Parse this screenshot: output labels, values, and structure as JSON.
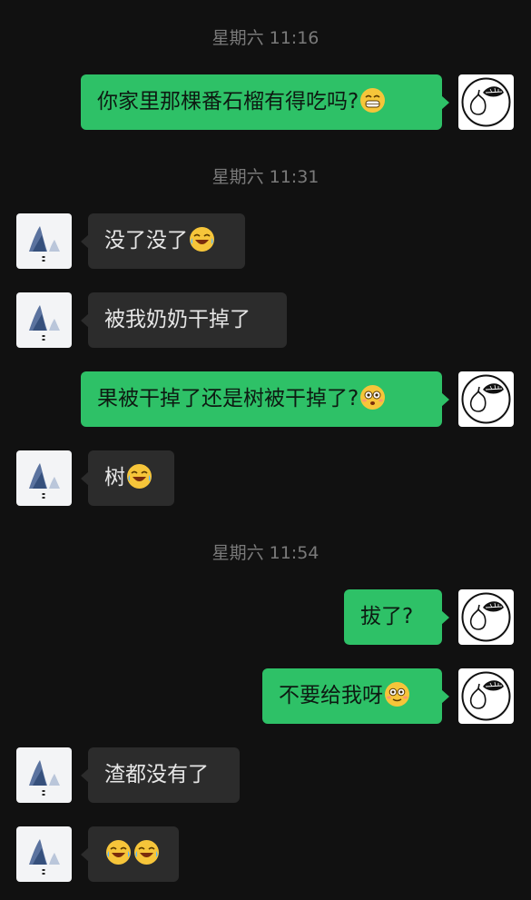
{
  "colors": {
    "background": "#111111",
    "sent_bubble": "#2ec167",
    "received_bubble": "#2c2c2c",
    "timestamp_text": "#7a7a7a"
  },
  "timestamps": [
    "星期六 11:16",
    "星期六 11:31",
    "星期六 11:54"
  ],
  "messages": [
    {
      "from": "me",
      "text": "你家里那棵番石榴有得吃吗?",
      "emoji": "grinning-sweat-emoji"
    },
    {
      "from": "friend",
      "text": "没了没了",
      "emoji": "laugh-cry-emoji"
    },
    {
      "from": "friend",
      "text": "被我奶奶干掉了",
      "emoji": ""
    },
    {
      "from": "me",
      "text": "果被干掉了还是树被干掉了?",
      "emoji": "flushed-emoji"
    },
    {
      "from": "friend",
      "text": "树",
      "emoji": "laugh-cry-emoji"
    },
    {
      "from": "me",
      "text": "拔了?",
      "emoji": ""
    },
    {
      "from": "me",
      "text": "不要给我呀",
      "emoji": "flushed-smile-emoji"
    },
    {
      "from": "friend",
      "text": "渣都没有了",
      "emoji": ""
    },
    {
      "from": "friend",
      "text": "",
      "emoji": "laugh-cry-emoji ×2"
    }
  ],
  "avatars": {
    "me": "guava-logo-avatar",
    "friend": "ink-landscape-avatar"
  }
}
